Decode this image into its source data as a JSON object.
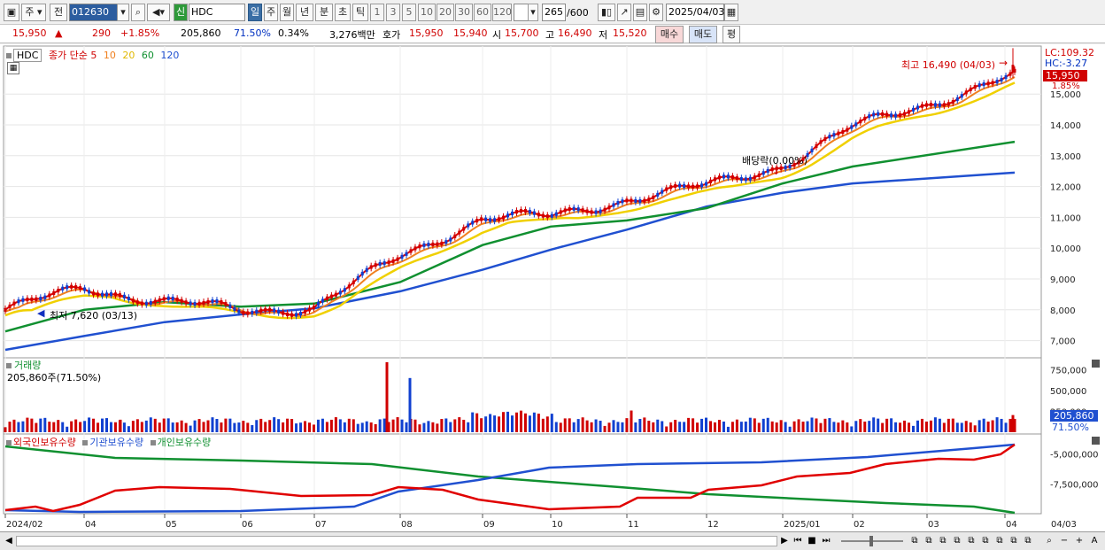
{
  "toolbar": {
    "mode": "주",
    "prev": "전",
    "stock_code": "012630",
    "stock_name_badge": "신",
    "stock_name": "HDC",
    "periods": [
      "일",
      "주",
      "월",
      "년",
      "분",
      "초",
      "틱"
    ],
    "active_period": "일",
    "intervals": [
      "1",
      "3",
      "5",
      "10",
      "20",
      "30",
      "60",
      "120"
    ],
    "count_value": "265",
    "count_max": "/600",
    "date": "2025/04/03"
  },
  "quote": {
    "price": "15,950",
    "change": "290",
    "change_pct": "+1.85%",
    "volume": "205,860",
    "vol_ratio": "71.50%",
    "turnover": "0.34%",
    "amount": "3,276백만",
    "hoga_label": "호가",
    "ask": "15,950",
    "bid": "15,940",
    "open_label": "시",
    "open": "15,700",
    "high_label": "고",
    "high": "16,490",
    "low_label": "저",
    "low": "15,520",
    "buy_label": "매수",
    "sell_label": "매도",
    "eval_label": "평"
  },
  "price_panel": {
    "name_tag": "HDC",
    "legend_prefix": "종가 단순",
    "ma_legend": [
      "5",
      "10",
      "20",
      "60",
      "120"
    ],
    "ma_colors": [
      "#e00000",
      "#f08020",
      "#f0d000",
      "#109030",
      "#2050d0"
    ],
    "lc": "LC:109.32",
    "hc": "HC:-3.27",
    "last_price_tag": "15,950",
    "last_pct_tag": "1.85%",
    "high_note": "최고 16,490 (04/03)",
    "low_note": "최저 7,620 (03/13)",
    "dividend_note": "배당락(0.00%)",
    "y_ticks": [
      "15,000",
      "14,000",
      "13,000",
      "12,000",
      "11,000",
      "10,000",
      "9,000",
      "8,000",
      "7,000"
    ]
  },
  "volume_panel": {
    "title": "거래량",
    "value_label": "205,860주(71.50%)",
    "y_ticks": [
      "750,000",
      "500,000",
      "250,000"
    ],
    "last_tag": "205,860",
    "last_pct": "71.50%"
  },
  "holding_panel": {
    "legend": [
      "외국인보유수량",
      "기관보유수량",
      "개인보유수량"
    ],
    "legend_colors": [
      "#d00000",
      "#2050d0",
      "#109030"
    ],
    "y_ticks": [
      "-5,000,000",
      "-7,500,000"
    ]
  },
  "x_axis": [
    "2024/02",
    "04",
    "05",
    "06",
    "07",
    "08",
    "09",
    "10",
    "11",
    "12",
    "2025/01",
    "02",
    "03",
    "04",
    "04/03"
  ],
  "chart_data": [
    {
      "type": "line",
      "title": "HDC",
      "series": [
        {
          "name": "120",
          "values": [
            6700,
            7150,
            7600,
            7850,
            8050,
            8600,
            9300,
            9950,
            10600,
            11350,
            11800,
            12100,
            12450
          ]
        },
        {
          "name": "60",
          "values": [
            7300,
            8000,
            8250,
            8100,
            8200,
            8900,
            10100,
            10700,
            10900,
            11300,
            12100,
            12650,
            13450
          ]
        },
        {
          "name": "5",
          "values": [
            8000,
            8700,
            8300,
            7950,
            8100,
            9700,
            11000,
            11000,
            11600,
            12000,
            12700,
            13900,
            15600
          ]
        }
      ],
      "x": [
        "2024/02",
        "04",
        "05",
        "06",
        "07",
        "08",
        "09",
        "10",
        "11",
        "12",
        "2025/01",
        "02",
        "04"
      ],
      "ylim": [
        6500,
        16500
      ]
    },
    {
      "type": "bar",
      "title": "거래량",
      "values": [
        150000,
        840000,
        650000,
        260000,
        205860
      ],
      "categories": [
        "04",
        "08",
        "08",
        "11",
        "04/03"
      ],
      "ylim": [
        0,
        850000
      ]
    }
  ],
  "scrollbar": {
    "zoom_minus": "−",
    "zoom_plus": "+",
    "zoom_a": "A"
  }
}
